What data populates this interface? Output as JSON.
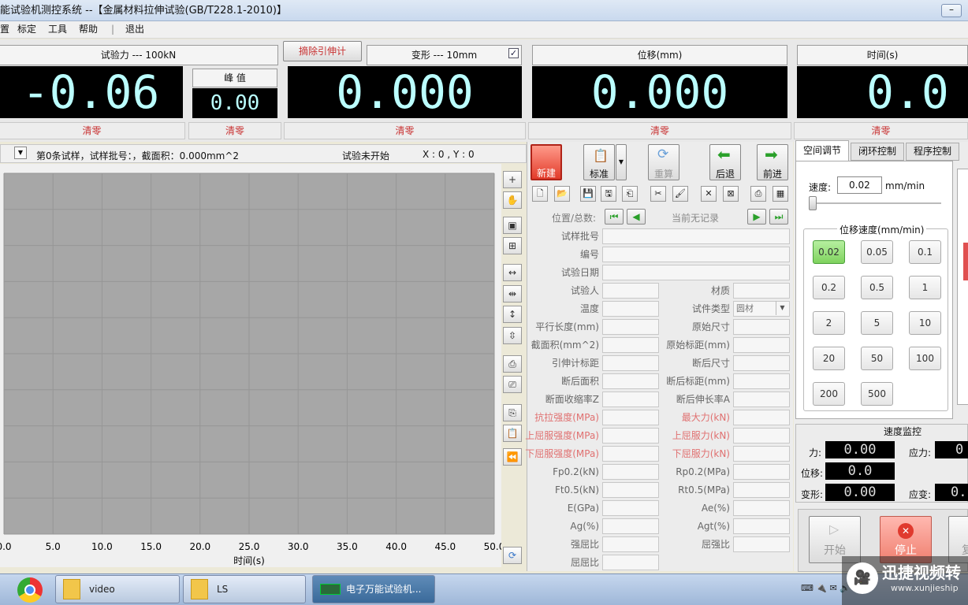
{
  "window": {
    "title": "能试验机测控系统 --【金属材料拉伸试验(GB/T228.1-2010)】",
    "min_btn": "–"
  },
  "menu": {
    "items": [
      "置",
      "标定",
      "工具",
      "帮助",
      "|",
      "退出"
    ]
  },
  "panels": {
    "force": {
      "label": "试验力 --- 100kN",
      "value": "-0.06",
      "zero": "清零"
    },
    "peak": {
      "label": "峰 值",
      "value": "0.00",
      "zero": "清零"
    },
    "extens_btn": "摘除引伸计",
    "deform": {
      "label": "变形 --- 10mm",
      "value": "0.000",
      "zero": "清零"
    },
    "disp": {
      "label": "位移(mm)",
      "value": "0.000",
      "zero": "清零"
    },
    "time": {
      "label": "时间(s)",
      "value": "0.0",
      "zero": "清零"
    }
  },
  "status": {
    "sample": "第0条试样，试样批号：，截面积：0.000mm^2",
    "state": "试验未开始",
    "coords": "X : 0 , Y : 0"
  },
  "chart_data": {
    "type": "line",
    "x_ticks": [
      "0.0",
      "5.0",
      "10.0",
      "15.0",
      "20.0",
      "25.0",
      "30.0",
      "35.0",
      "40.0",
      "45.0",
      "50.0"
    ],
    "xlabel": "时间(s)",
    "xlim": [
      0,
      50
    ],
    "grid": true,
    "series": []
  },
  "toolbar": {
    "new": "新建",
    "standard": "标准",
    "recalc": "重算",
    "back": "后退",
    "forward": "前进"
  },
  "record": {
    "pos_label": "位置/总数:",
    "current": "当前无记录"
  },
  "fields": {
    "batch": "试样批号",
    "number": "编号",
    "date": "试验日期",
    "left": [
      "试验人",
      "温度",
      "平行长度(mm)",
      "截面积(mm^2)",
      "引伸计标距",
      "断后面积",
      "断面收缩率Z",
      "抗拉强度(MPa)",
      "上屈服强度(MPa)",
      "下屈服强度(MPa)",
      "Fp0.2(kN)",
      "Ft0.5(kN)",
      "E(GPa)",
      "Ag(%)",
      "强屈比",
      "屈屈比"
    ],
    "right": [
      "材质",
      "试件类型",
      "原始尺寸",
      "原始标距(mm)",
      "断后尺寸",
      "断后标距(mm)",
      "断后伸长率A",
      "最大力(kN)",
      "上屈服力(kN)",
      "下屈服力(kN)",
      "Rp0.2(MPa)",
      "Rt0.5(MPa)",
      "Ae(%)",
      "Agt(%)",
      "屈强比"
    ],
    "type_value": "圆材"
  },
  "tabs": [
    "空间调节",
    "闭环控制",
    "程序控制"
  ],
  "speed": {
    "label": "速度:",
    "value": "0.02",
    "unit": "mm/min",
    "group": "位移速度(mm/min)",
    "buttons": [
      "0.02",
      "0.05",
      "0.1",
      "0.2",
      "0.5",
      "1",
      "2",
      "5",
      "10",
      "20",
      "50",
      "100",
      "200",
      "500"
    ]
  },
  "monitor": {
    "title": "速度监控",
    "force_l": "力:",
    "force_v": "0.00",
    "stress_l": "应力:",
    "stress_v": "0",
    "disp_l": "位移:",
    "disp_v": "0.0",
    "deform_l": "变形:",
    "deform_v": "0.00",
    "strain_l": "应变:",
    "strain_v": "0."
  },
  "controls": {
    "start": "开始",
    "stop": "停止",
    "third": "复"
  },
  "taskbar": {
    "items": [
      "video",
      "LS",
      "电子万能试验机..."
    ],
    "watermark": "迅捷视频转",
    "watermark_url": "www.xunjieship"
  }
}
